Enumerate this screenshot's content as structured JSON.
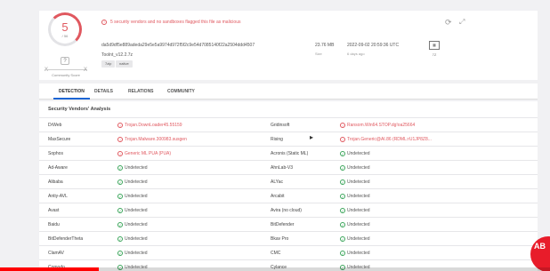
{
  "header": {
    "score": "5",
    "score_total": "/ 56",
    "community_label": "Community Score",
    "cs_question": "?",
    "cs_min": "X",
    "cs_max": "X",
    "alert_text": "5 security vendors and no sandboxes flagged this file as malicious",
    "hash": "da5d9df5e889adeda29e5e5a9974d972f5f2c9e54d7085140f22a2504ddd4507",
    "filename": "Toolnt_v12.2.7z",
    "tags": [
      "7zip",
      "native"
    ],
    "size": "23.76 MB",
    "size_label": "Size",
    "date": "2022-09-02 20:59:36 UTC",
    "date_ago": "6 days ago",
    "file_type": "7Z",
    "icons": {
      "alert": "alert-icon",
      "reload": "reload-icon",
      "expand": "expand-icon",
      "file": "file-icon"
    }
  },
  "tabs": [
    "DETECTION",
    "DETAILS",
    "RELATIONS",
    "COMMUNITY"
  ],
  "section_title": "Security Vendors' Analysis",
  "colors": {
    "malicious": "#e0585f",
    "undetected": "#3aa55a",
    "tab_accent": "#1b64d3"
  },
  "vendors": [
    {
      "left": {
        "name": "DrWeb",
        "result": "Trojan.DownLoader45.55159",
        "malicious": true
      },
      "right": {
        "name": "Gridinsoft",
        "result": "Ransom.Win64.STOP.dg!oa25664",
        "malicious": true
      }
    },
    {
      "left": {
        "name": "MaxSecure",
        "result": "Trojan.Malware.300983.susgen",
        "malicious": true
      },
      "right": {
        "name": "Rising",
        "result": "Trojan.Generic@AI.86 (RDML:rU1JP8Z8...",
        "malicious": true
      }
    },
    {
      "left": {
        "name": "Sophos",
        "result": "Generic ML PUA (PUA)",
        "malicious": true
      },
      "right": {
        "name": "Acronis (Static ML)",
        "result": "Undetected",
        "malicious": false
      }
    },
    {
      "left": {
        "name": "Ad-Aware",
        "result": "Undetected",
        "malicious": false
      },
      "right": {
        "name": "AhnLab-V3",
        "result": "Undetected",
        "malicious": false
      }
    },
    {
      "left": {
        "name": "Alibaba",
        "result": "Undetected",
        "malicious": false
      },
      "right": {
        "name": "ALYac",
        "result": "Undetected",
        "malicious": false
      }
    },
    {
      "left": {
        "name": "Antiy-AVL",
        "result": "Undetected",
        "malicious": false
      },
      "right": {
        "name": "Arcabit",
        "result": "Undetected",
        "malicious": false
      }
    },
    {
      "left": {
        "name": "Avast",
        "result": "Undetected",
        "malicious": false
      },
      "right": {
        "name": "Avira (no cloud)",
        "result": "Undetected",
        "malicious": false
      }
    },
    {
      "left": {
        "name": "Baidu",
        "result": "Undetected",
        "malicious": false
      },
      "right": {
        "name": "BitDefender",
        "result": "Undetected",
        "malicious": false
      }
    },
    {
      "left": {
        "name": "BitDefenderTheta",
        "result": "Undetected",
        "malicious": false
      },
      "right": {
        "name": "Bkav Pro",
        "result": "Undetected",
        "malicious": false
      }
    },
    {
      "left": {
        "name": "ClamAV",
        "result": "Undetected",
        "malicious": false
      },
      "right": {
        "name": "CMC",
        "result": "Undetected",
        "malicious": false
      }
    },
    {
      "left": {
        "name": "Comodo",
        "result": "Undetected",
        "malicious": false
      },
      "right": {
        "name": "Cylance",
        "result": "Undetected",
        "malicious": false
      }
    }
  ],
  "overlay": {
    "logo_text": "AB",
    "video_progress": 0.18
  }
}
